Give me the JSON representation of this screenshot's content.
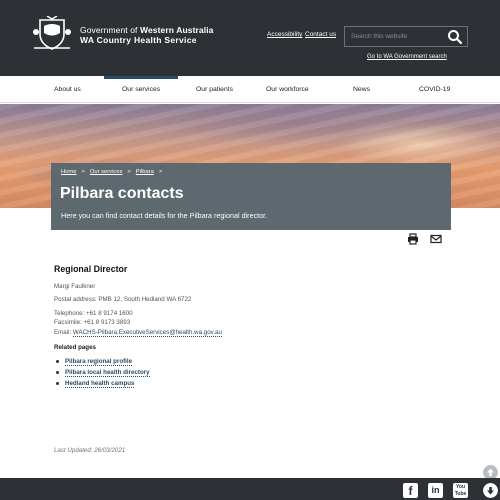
{
  "header": {
    "gov_prefix": "Government of ",
    "gov_state": "Western Australia",
    "service_name": "WA Country Health Service",
    "accessibility_label": "Accessibility",
    "contact_label": "Contact us",
    "search_placeholder": "Search this website",
    "goto_gov_label": "Go to WA Government search"
  },
  "nav": {
    "items": [
      "About us",
      "Our services",
      "Our patients",
      "Our workforce",
      "News",
      "COVID-19"
    ],
    "active": "Our services"
  },
  "breadcrumb": {
    "items": [
      "Home",
      "Our services",
      "Pilbara"
    ],
    "separator": ">"
  },
  "page": {
    "title": "Pilbara contacts",
    "description": "Here you can find contact details for the Pilbara regional director."
  },
  "tools": {
    "icons": [
      "print-icon",
      "email-icon"
    ]
  },
  "content": {
    "section_title": "Regional Director",
    "name": "Margi Faulkner",
    "postal": "Postal address: PMB 12, South Hedland WA 6722",
    "telephone": "Telephone: +61 8 9174 1600",
    "facsimile": "Facsimile: +61 8 9173 3893",
    "email_label": "Email: ",
    "email": "WACHS-Pilbara.ExecutiveServices@health.wa.gov.au",
    "related_title": "Related pages",
    "related": [
      "Pilbara regional profile",
      "Pilbara local health directory",
      "Hedland health campus"
    ],
    "last_updated": "Last Updated: 26/03/2021"
  },
  "footer": {
    "social": [
      {
        "name": "facebook-icon",
        "glyph": "f"
      },
      {
        "name": "linkedin-icon",
        "glyph": "in"
      },
      {
        "name": "youtube-icon",
        "glyph": "You Tube"
      }
    ]
  },
  "colors": {
    "header_bg": "#2d3034",
    "panel_bg": "#5e686f",
    "link": "#2b4a63",
    "active_nav": "#2b4a63"
  }
}
